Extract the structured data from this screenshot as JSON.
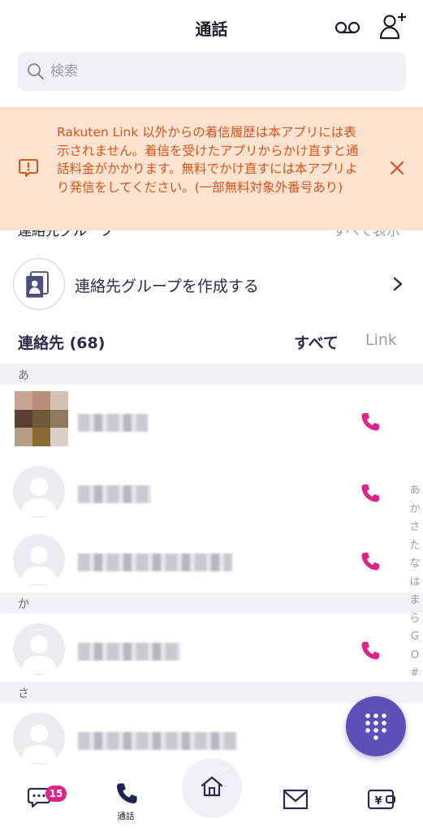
{
  "header": {
    "title": "通話"
  },
  "search": {
    "placeholder": "検索"
  },
  "groups_row": {
    "title": "連絡先グループ",
    "show_all": "すべて表示"
  },
  "banner": {
    "message": "Rakuten Link 以外からの着信履歴は本アプリには表示されません。着信を受けたアプリからかけ直すと通話料金がかかります。無料でかけ直すには本アプリより発信をしてください。(一部無料対象外番号あり)"
  },
  "create_group": {
    "label": "連絡先グループを作成する"
  },
  "contacts": {
    "title": "連絡先 (68)",
    "filter_all": "すべて",
    "filter_link": "Link"
  },
  "sections": [
    {
      "label": "あ"
    },
    {
      "label": "か"
    },
    {
      "label": "さ"
    }
  ],
  "index_bar": [
    "あ",
    "か",
    "さ",
    "た",
    "な",
    "は",
    "ま",
    "ら",
    "G",
    "O",
    "#"
  ],
  "tabbar": {
    "messages_badge": "15",
    "calls_label": "通話"
  },
  "colors": {
    "accent": "#5b4fb8",
    "call": "#e0238a",
    "banner_bg": "#fbe3d0",
    "banner_text": "#d9531e"
  }
}
